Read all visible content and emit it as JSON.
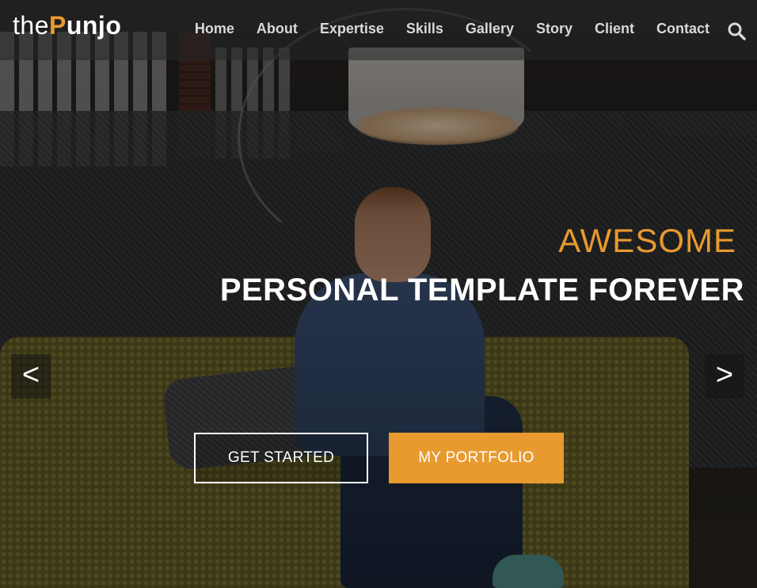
{
  "brand": {
    "prefix": "the",
    "highlight": "P",
    "suffix": "unjo",
    "accent_color": "#e89a2f"
  },
  "nav": {
    "items": [
      {
        "label": "Home"
      },
      {
        "label": "About"
      },
      {
        "label": "Expertise"
      },
      {
        "label": "Skills"
      },
      {
        "label": "Gallery"
      },
      {
        "label": "Story"
      },
      {
        "label": "Client"
      },
      {
        "label": "Contact"
      }
    ],
    "search_icon": "search-icon"
  },
  "hero": {
    "subtitle": "AWESOME",
    "title": "PERSONAL TEMPLATE FOREVER",
    "prev_arrow": "<",
    "next_arrow": ">",
    "buttons": {
      "get_started": "GET STARTED",
      "portfolio": "MY PORTFOLIO"
    }
  },
  "colors": {
    "accent": "#e89a2f",
    "text": "#ffffff",
    "nav_text": "#d8d8d8"
  }
}
